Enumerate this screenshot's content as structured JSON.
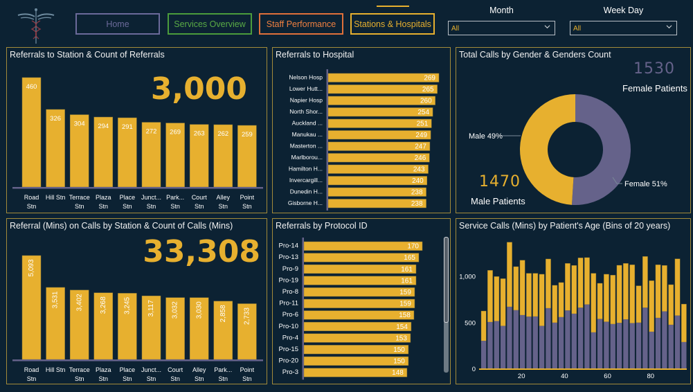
{
  "header": {
    "logo": "caduceus-icon",
    "nav": [
      {
        "label": "Home",
        "color": "#6b6a9a"
      },
      {
        "label": "Services Overview",
        "color": "#5aab45"
      },
      {
        "label": "Staff Performance",
        "color": "#f08040"
      },
      {
        "label": "Stations & Hospitals",
        "color": "#e7b02f",
        "active": true
      }
    ],
    "filters": [
      {
        "label": "Month",
        "value": "All"
      },
      {
        "label": "Week Day",
        "value": "All"
      }
    ]
  },
  "colors": {
    "background": "#0c2233",
    "accent": "#e7b02f",
    "secondary": "#65628a",
    "panel_border": "#a38b3a"
  },
  "panels": {
    "referrals_station": {
      "title": "Referrals to Station & Count of Referrals",
      "kpi": "3,000"
    },
    "referrals_hospital": {
      "title": "Referrals to Hospital"
    },
    "gender": {
      "title": "Total Calls by Gender & Genders Count",
      "female_count": "1530",
      "female_label": "Female Patients",
      "male_count": "1470",
      "male_label": "Male Patients"
    },
    "referral_mins": {
      "title": "Referral (Mins) on Calls by Station & Count of Calls (Mins)",
      "kpi": "33,308"
    },
    "protocol": {
      "title": "Referrals by Protocol ID"
    },
    "age": {
      "title": "Service Calls (Mins) by Patient's Age (Bins of 20 years)"
    }
  },
  "chart_data": [
    {
      "id": "referrals_station",
      "type": "bar",
      "title": "Referrals to Station & Count of Referrals",
      "categories": [
        [
          "Road",
          "Stn"
        ],
        [
          "Hill Stn",
          ""
        ],
        [
          "Terrace",
          "Stn"
        ],
        [
          "Plaza",
          "Stn"
        ],
        [
          "Place",
          "Stn"
        ],
        [
          "Junct...",
          "Stn"
        ],
        [
          "Park...",
          "Stn"
        ],
        [
          "Court",
          "Stn"
        ],
        [
          "Alley",
          "Stn"
        ],
        [
          "Point",
          "Stn"
        ]
      ],
      "values": [
        460,
        326,
        304,
        294,
        291,
        272,
        269,
        263,
        262,
        259
      ],
      "labels": [
        "460",
        "326",
        "304",
        "294",
        "291",
        "272",
        "269",
        "263",
        "262",
        "259"
      ]
    },
    {
      "id": "referrals_hospital",
      "type": "bar",
      "orientation": "horizontal",
      "title": "Referrals to Hospital",
      "categories": [
        "Nelson Hosp",
        "Lower Hutt...",
        "Napier Hosp",
        "North Shor...",
        "Auckland ...",
        "Manukau ...",
        "Masterton ...",
        "Marlborou...",
        "Hamilton H...",
        "Invercargill...",
        "Dunedin H...",
        "Gisborne H..."
      ],
      "values": [
        269,
        265,
        260,
        254,
        251,
        249,
        247,
        246,
        243,
        240,
        238,
        238
      ]
    },
    {
      "id": "gender",
      "type": "pie",
      "donut": true,
      "title": "Total Calls by Gender & Genders Count",
      "slices": [
        {
          "name": "Female",
          "value": 51,
          "label": "Female 51%",
          "color": "#65628a"
        },
        {
          "name": "Male",
          "value": 49,
          "label": "Male 49%",
          "color": "#e7b02f"
        }
      ]
    },
    {
      "id": "referral_mins",
      "type": "bar",
      "title": "Referral (Mins) on Calls by Station & Count of Calls (Mins)",
      "categories": [
        [
          "Road",
          "Stn"
        ],
        [
          "Hill Stn",
          ""
        ],
        [
          "Terrace",
          "Stn"
        ],
        [
          "Plaza",
          "Stn"
        ],
        [
          "Place",
          "Stn"
        ],
        [
          "Junct...",
          "Stn"
        ],
        [
          "Court",
          "Stn"
        ],
        [
          "Alley",
          "Stn"
        ],
        [
          "Park...",
          "Stn"
        ],
        [
          "Point",
          "Stn"
        ]
      ],
      "values": [
        5093,
        3531,
        3402,
        3268,
        3245,
        3117,
        3032,
        3030,
        2858,
        2733
      ],
      "labels": [
        "5,093",
        "3,531",
        "3,402",
        "3,268",
        "3,245",
        "3,117",
        "3,032",
        "3,030",
        "2,858",
        "2,733"
      ]
    },
    {
      "id": "protocol",
      "type": "bar",
      "orientation": "horizontal",
      "title": "Referrals by Protocol ID",
      "categories": [
        "Pro-14",
        "Pro-13",
        "Pro-9",
        "Pro-19",
        "Pro-8",
        "Pro-11",
        "Pro-6",
        "Pro-10",
        "Pro-4",
        "Pro-15",
        "Pro-20",
        "Pro-3"
      ],
      "values": [
        170,
        165,
        161,
        161,
        159,
        159,
        158,
        154,
        153,
        150,
        150,
        148
      ]
    },
    {
      "id": "age",
      "type": "bar",
      "stacked": true,
      "title": "Service Calls (Mins) by Patient's Age (Bins of 20 years)",
      "ylim": [
        0,
        1400
      ],
      "yticks": [
        0,
        500,
        1000
      ],
      "ytick_labels": [
        "0",
        "500",
        "1,000"
      ],
      "xlim": [
        0,
        95
      ],
      "xticks": [
        20,
        40,
        60,
        80
      ],
      "x": [
        1,
        4,
        7,
        10,
        13,
        16,
        19,
        22,
        25,
        28,
        31,
        34,
        37,
        40,
        43,
        46,
        49,
        52,
        55,
        58,
        61,
        64,
        67,
        70,
        73,
        76,
        79,
        82,
        85,
        88,
        91,
        94
      ],
      "series": [
        {
          "name": "lower",
          "color": "#65628a",
          "values": [
            298,
            502,
            512,
            460,
            667,
            630,
            577,
            560,
            562,
            460,
            652,
            495,
            555,
            627,
            592,
            657,
            692,
            390,
            535,
            505,
            480,
            492,
            530,
            490,
            495,
            657,
            397,
            547,
            617,
            472,
            572,
            285
          ]
        },
        {
          "name": "upper",
          "color": "#e7b02f",
          "values": [
            324,
            560,
            483,
            512,
            700,
            472,
            595,
            470,
            468,
            560,
            533,
            405,
            375,
            510,
            523,
            540,
            508,
            640,
            387,
            515,
            530,
            625,
            607,
            632,
            400,
            555,
            553,
            575,
            498,
            435,
            615,
            412
          ]
        }
      ]
    }
  ]
}
